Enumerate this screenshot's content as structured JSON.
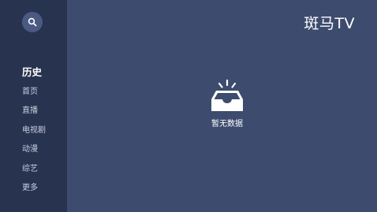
{
  "app": {
    "brand": "斑马TV"
  },
  "sidebar": {
    "search_icon": "search-icon",
    "items": [
      {
        "label": "历史",
        "active": true
      },
      {
        "label": "首页",
        "active": false
      },
      {
        "label": "直播",
        "active": false
      },
      {
        "label": "电视剧",
        "active": false
      },
      {
        "label": "动漫",
        "active": false
      },
      {
        "label": "综艺",
        "active": false
      },
      {
        "label": "更多",
        "active": false
      }
    ]
  },
  "main": {
    "empty_icon": "empty-inbox-icon",
    "empty_text": "暂无数据"
  },
  "colors": {
    "background": "#3d4b6e",
    "sidebar": "#283350",
    "search_button": "#4a5a82",
    "text_active": "#ffffff",
    "text_inactive": "#c9cfde"
  }
}
